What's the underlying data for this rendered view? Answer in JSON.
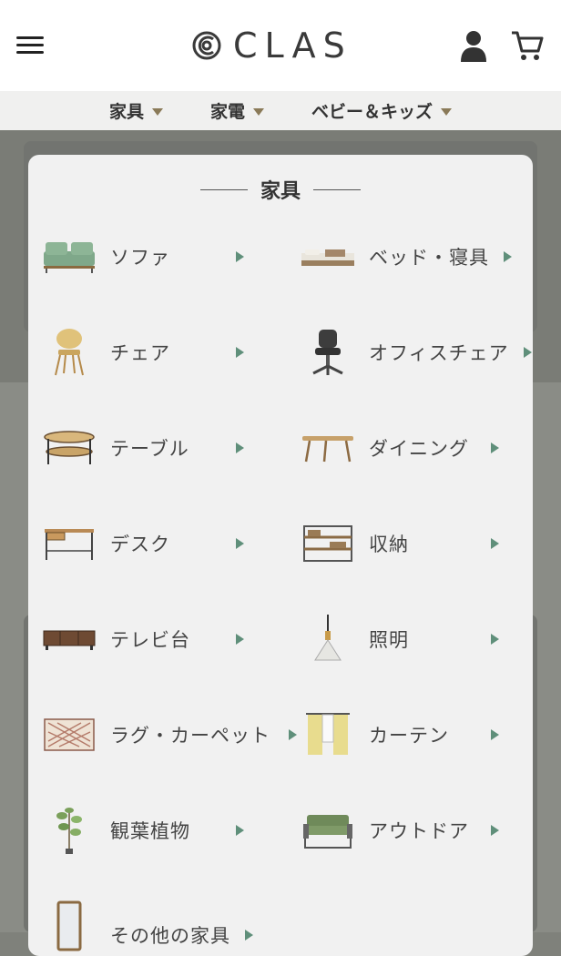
{
  "header": {
    "brand": "CLAS",
    "icons": [
      "menu-icon",
      "account-icon",
      "cart-icon"
    ]
  },
  "catnav": {
    "items": [
      {
        "label": "家具"
      },
      {
        "label": "家電"
      },
      {
        "label": "ベビー＆キッズ"
      }
    ]
  },
  "panel": {
    "title": "家具",
    "items": [
      {
        "label": "ソファ",
        "icon": "sofa-icon"
      },
      {
        "label": "ベッド・寝具",
        "icon": "bed-icon"
      },
      {
        "label": "チェア",
        "icon": "chair-icon"
      },
      {
        "label": "オフィスチェア",
        "icon": "office-chair-icon"
      },
      {
        "label": "テーブル",
        "icon": "table-icon"
      },
      {
        "label": "ダイニング",
        "icon": "dining-icon"
      },
      {
        "label": "デスク",
        "icon": "desk-icon"
      },
      {
        "label": "収納",
        "icon": "storage-icon"
      },
      {
        "label": "テレビ台",
        "icon": "tv-stand-icon"
      },
      {
        "label": "照明",
        "icon": "lamp-icon"
      },
      {
        "label": "ラグ・カーペット",
        "icon": "rug-icon"
      },
      {
        "label": "カーテン",
        "icon": "curtain-icon"
      },
      {
        "label": "観葉植物",
        "icon": "plant-icon"
      },
      {
        "label": "アウトドア",
        "icon": "outdoor-icon"
      },
      {
        "label": "その他の家具",
        "icon": "mirror-icon"
      }
    ]
  },
  "colors": {
    "arrow": "#5f8f7a",
    "dropdown_triangle": "#8a7a58",
    "overlay": "#7f817b"
  }
}
